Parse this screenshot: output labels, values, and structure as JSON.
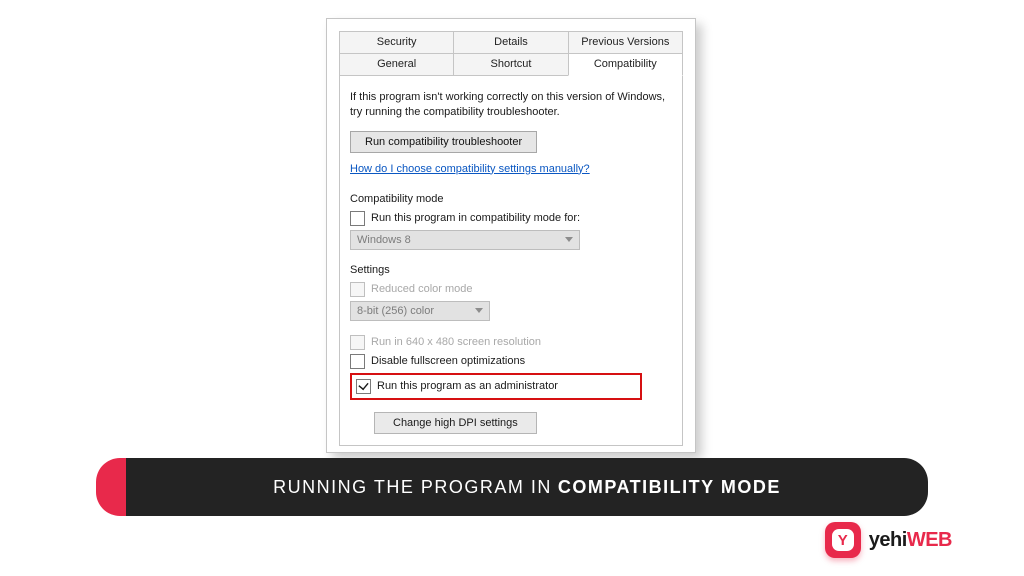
{
  "tabs": {
    "security": "Security",
    "details": "Details",
    "previous_versions": "Previous Versions",
    "general": "General",
    "shortcut": "Shortcut",
    "compatibility": "Compatibility"
  },
  "intro": "If this program isn't working correctly on this version of Windows, try running the compatibility troubleshooter.",
  "troubleshooter_button": "Run compatibility troubleshooter",
  "help_link": "How do I choose compatibility settings manually?",
  "compat_mode": {
    "label": "Compatibility mode",
    "checkbox": "Run this program in compatibility mode for:",
    "dropdown": "Windows 8"
  },
  "settings": {
    "label": "Settings",
    "reduced_color": "Reduced color mode",
    "color_dropdown": "8-bit (256) color",
    "low_res": "Run in 640 x 480 screen resolution",
    "disable_fullscreen": "Disable fullscreen optimizations",
    "run_as_admin": "Run this program as an administrator",
    "dpi_button": "Change high DPI settings"
  },
  "caption": {
    "pre": "RUNNING THE PROGRAM IN",
    "strong": "COMPATIBILITY MODE"
  },
  "brand": {
    "icon_letter": "Y",
    "name_a": "yehi",
    "name_b": "WEB"
  }
}
